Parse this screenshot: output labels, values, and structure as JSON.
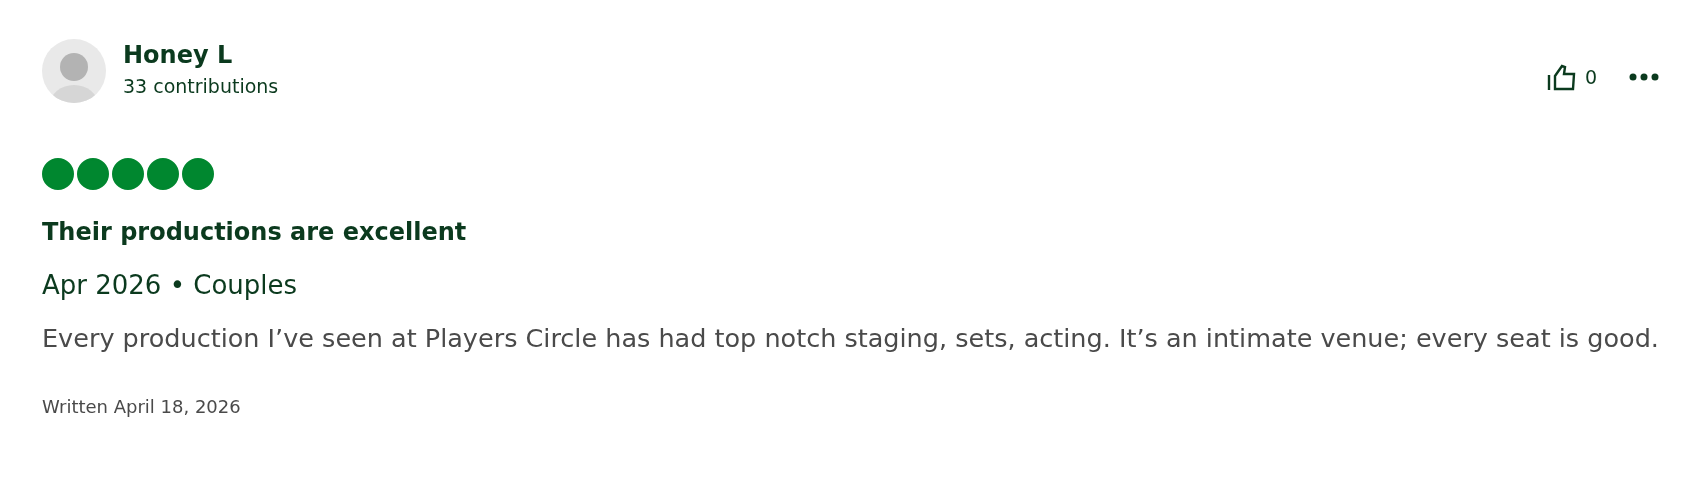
{
  "reviewer": {
    "name": "Honey L",
    "contributions": "33 contributions"
  },
  "helpful": {
    "count": "0"
  },
  "review": {
    "stars": 5,
    "title": "Their productions are excellent",
    "meta": "Apr 2026 • Couples",
    "body": "Every production I’ve seen at Players Circle has had top notch staging, sets, acting. It’s an intimate venue; every seat is good.",
    "written": "Written April 18, 2026"
  }
}
